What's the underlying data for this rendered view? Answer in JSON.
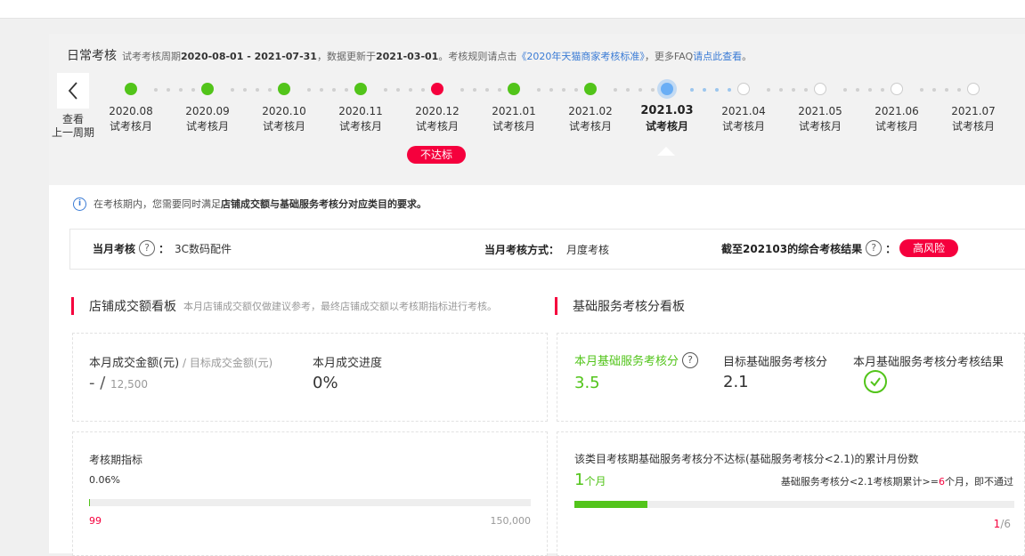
{
  "heading": {
    "title": "日常考核",
    "period_prefix": "试考考核周期",
    "period": "2020-08-01 - 2021-07-31",
    "update_prefix": "，数据更新于",
    "update_date": "2021-03-01",
    "rule_prefix": "。考核规则请点击",
    "rule_link": "《2020年天猫商家考核标准》",
    "faq_prefix": "，更多FAQ",
    "faq_link": "请点此查看",
    "faq_suffix": "。"
  },
  "prev_period": {
    "line1": "查看",
    "line2": "上一周期"
  },
  "months": [
    {
      "date": "2020.08",
      "label": "试考核月",
      "status": "green"
    },
    {
      "date": "2020.09",
      "label": "试考核月",
      "status": "green"
    },
    {
      "date": "2020.10",
      "label": "试考核月",
      "status": "green"
    },
    {
      "date": "2020.11",
      "label": "试考核月",
      "status": "green"
    },
    {
      "date": "2020.12",
      "label": "试考核月",
      "status": "red"
    },
    {
      "date": "2021.01",
      "label": "试考核月",
      "status": "green"
    },
    {
      "date": "2021.02",
      "label": "试考核月",
      "status": "green"
    },
    {
      "date": "2021.03",
      "label": "试考核月",
      "status": "current"
    },
    {
      "date": "2021.04",
      "label": "试考核月",
      "status": "future"
    },
    {
      "date": "2021.05",
      "label": "试考核月",
      "status": "future"
    },
    {
      "date": "2021.06",
      "label": "试考核月",
      "status": "future"
    },
    {
      "date": "2021.07",
      "label": "试考核月",
      "status": "future"
    }
  ],
  "fail_badge": "不达标",
  "notice": {
    "prefix": "在考核期内，您需要同时满足",
    "bold": "店铺成交额与基础服务考核分对应类目的要求。"
  },
  "summary": {
    "month_label": "当月考核",
    "colon": "：",
    "category": "3C数码配件",
    "method_label": "当月考核方式：",
    "method": "月度考核",
    "result_label": "截至202103的综合考核结果",
    "risk": "高风险"
  },
  "sales_board": {
    "title": "店铺成交额看板",
    "subtitle": "本月店铺成交额仅做建议参考，最终店铺成交额以考核期指标进行考核。",
    "amount_label": "本月成交金额(元)",
    "target_label": " / 目标成交金额(元)",
    "amount_value": "- / ",
    "target_value": "12,500",
    "progress_label": "本月成交进度",
    "progress_value": "0%",
    "period_label": "考核期指标",
    "period_percent": "0.06%",
    "period_fraction": 0.0006,
    "min_value": "99",
    "max_value": "150,000"
  },
  "service_board": {
    "title": "基础服务考核分看板",
    "score_label": "本月基础服务考核分",
    "score_value": "3.5",
    "target_label": "目标基础服务考核分",
    "target_value": "2.1",
    "result_label": "本月基础服务考核分考核结果",
    "count_title": "该类目考核期基础服务考核分不达标(基础服务考核分<2.1)的累计月份数",
    "count_value": "1",
    "count_unit": "个月",
    "rule_prefix": "基础服务考核分<2.1考核期累计>=",
    "rule_num": "6",
    "rule_suffix": "个月，即不通过",
    "count_fraction": 0.1667,
    "page_current": "1",
    "page_total": "/6"
  },
  "colors": {
    "accent_red": "#f5003d",
    "success_green": "#52c41a",
    "link_blue": "#3a7bd5"
  },
  "icons": [
    "chevron-left-icon",
    "info-icon",
    "question-icon",
    "check-circle-icon"
  ]
}
